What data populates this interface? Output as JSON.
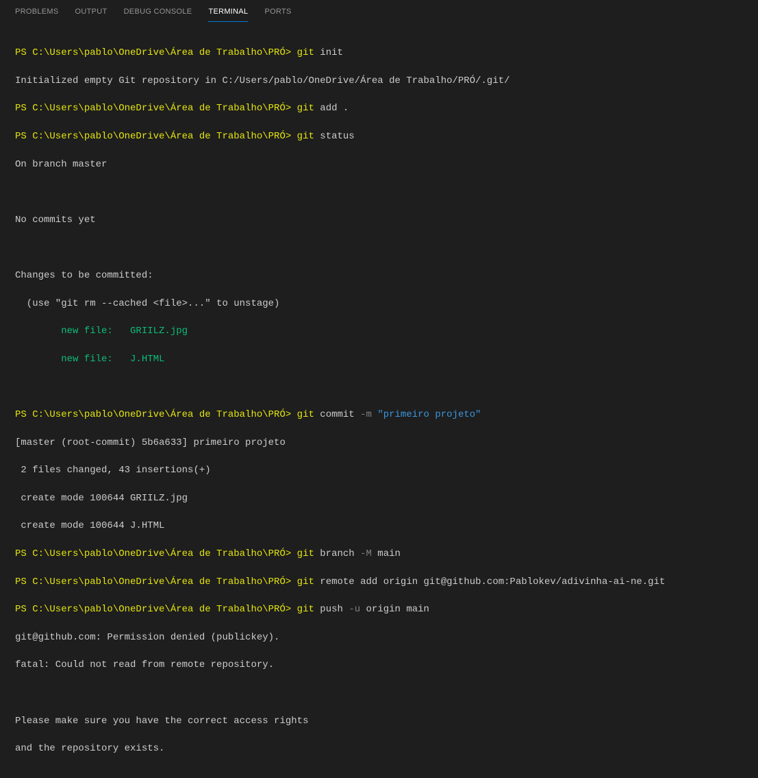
{
  "tabs": {
    "problems": "PROBLEMS",
    "output": "OUTPUT",
    "debug_console": "DEBUG CONSOLE",
    "terminal": "TERMINAL",
    "ports": "PORTS"
  },
  "prompt": "PS C:\\Users\\pablo\\OneDrive\\Área de Trabalho\\PRÓ>",
  "lines": {
    "l1_cmd": "git",
    "l1_args": " init",
    "l2": "Initialized empty Git repository in C:/Users/pablo/OneDrive/Área de Trabalho/PRÓ/.git/",
    "l3_cmd": "git",
    "l3_args": " add .",
    "l4_cmd": "git",
    "l4_args": " status",
    "l5": "On branch master",
    "l6": "No commits yet",
    "l7": "Changes to be committed:",
    "l8": "  (use \"git rm --cached <file>...\" to unstage)",
    "l9": "        new file:   GRIILZ.jpg",
    "l10": "        new file:   J.HTML",
    "l11_cmd": "git",
    "l11_args1": " commit ",
    "l11_flag": "-m",
    "l11_str": " \"primeiro projeto\"",
    "l12": "[master (root-commit) 5b6a633] primeiro projeto",
    "l13": " 2 files changed, 43 insertions(+)",
    "l14": " create mode 100644 GRIILZ.jpg",
    "l15": " create mode 100644 J.HTML",
    "l16_cmd": " git",
    "l16_args1": " branch ",
    "l16_flag": "-M",
    "l16_args2": " main",
    "l17_cmd": "git",
    "l17_args": " remote add origin git@github.com:Pablokev/adivinha-ai-ne.git",
    "l18_cmd": "git",
    "l18_args1": " push ",
    "l18_flag": "-u",
    "l18_args2": " origin main",
    "l19": "git@github.com: Permission denied (publickey).",
    "l20": "fatal: Could not read from remote repository.",
    "l21": "Please make sure you have the correct access rights",
    "l22": "and the repository exists."
  }
}
